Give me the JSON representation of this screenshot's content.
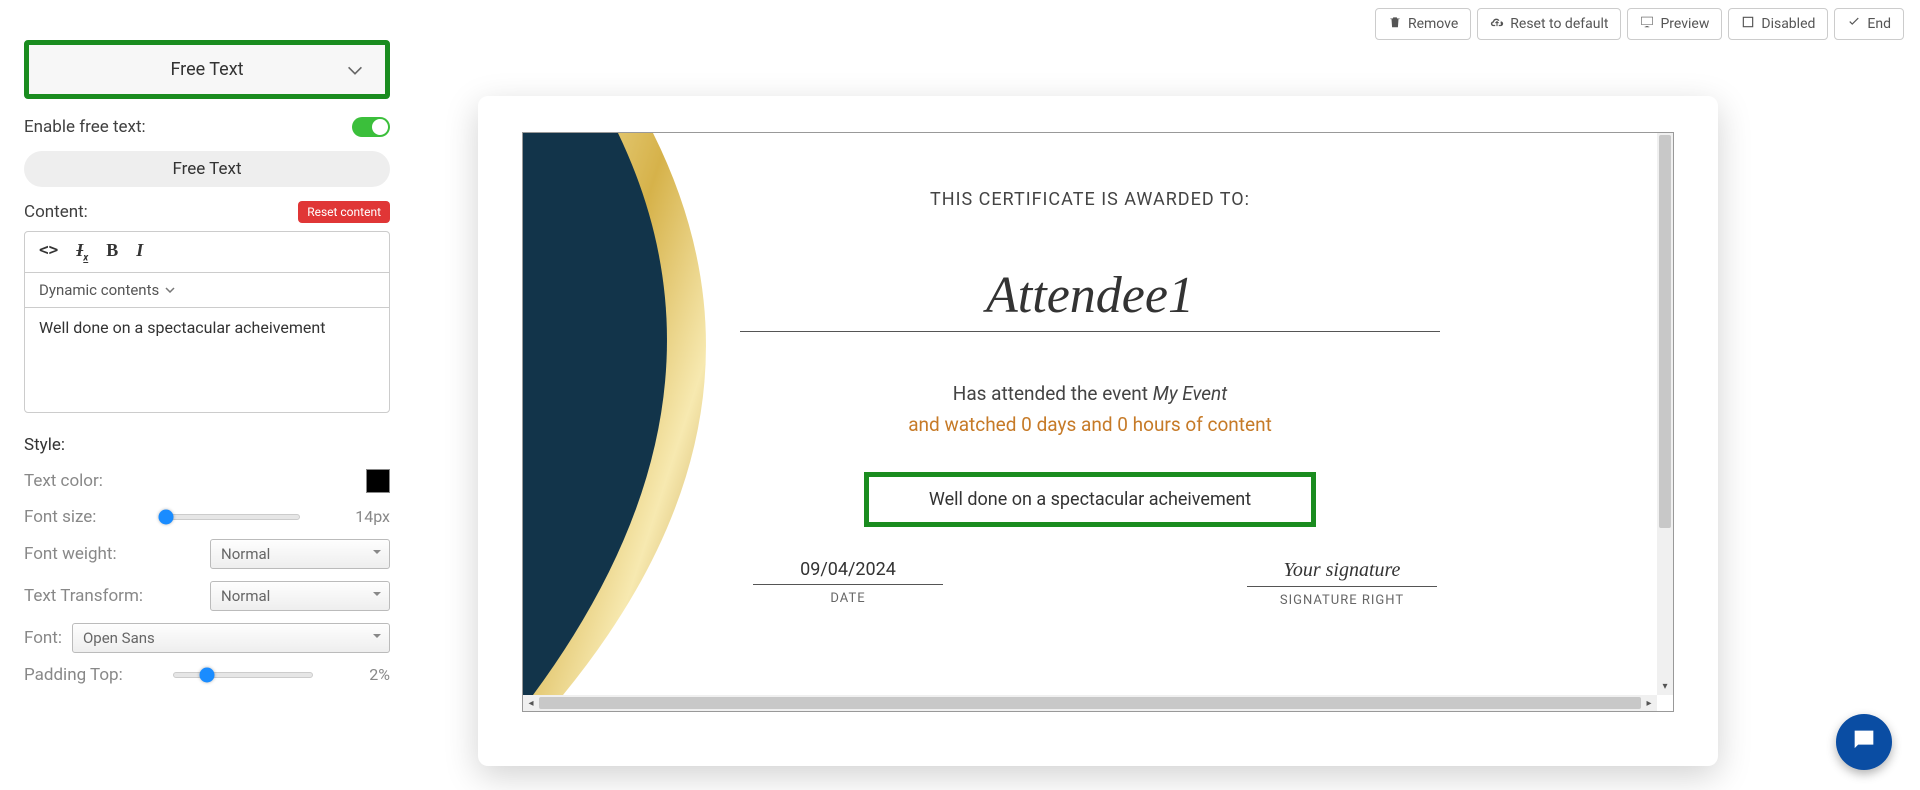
{
  "toolbar": {
    "remove": "Remove",
    "reset_default": "Reset to default",
    "preview": "Preview",
    "disabled": "Disabled",
    "end": "End"
  },
  "sidebar": {
    "section_title": "Free Text",
    "enable_label": "Enable free text:",
    "free_text_btn": "Free Text",
    "content_label": "Content:",
    "reset_content": "Reset content",
    "dynamic_label": "Dynamic contents",
    "content_value": "Well done on a spectacular acheivement",
    "style_label": "Style:",
    "text_color_label": "Text color:",
    "font_size_label": "Font size:",
    "font_size_value": "14px",
    "font_weight_label": "Font weight:",
    "font_weight_value": "Normal",
    "text_transform_label": "Text Transform:",
    "text_transform_value": "Normal",
    "font_label": "Font:",
    "font_value": "Open Sans",
    "padding_top_label": "Padding Top:",
    "padding_top_value": "2%"
  },
  "certificate": {
    "awarded_to": "THIS CERTIFICATE IS AWARDED TO:",
    "attendee": "Attendee1",
    "attended_prefix": "Has attended the event ",
    "event_name": "My Event",
    "watched_line": "and watched 0 days and 0 hours of content",
    "freetext": "Well done on a spectacular acheivement",
    "date_value": "09/04/2024",
    "date_label": "DATE",
    "sig_value": "Your signature",
    "sig_label": "SIGNATURE RIGHT"
  },
  "colors": {
    "highlight": "#1a8c1f",
    "accent_orange": "#c67a27",
    "chat_blue": "#0a4da3"
  }
}
